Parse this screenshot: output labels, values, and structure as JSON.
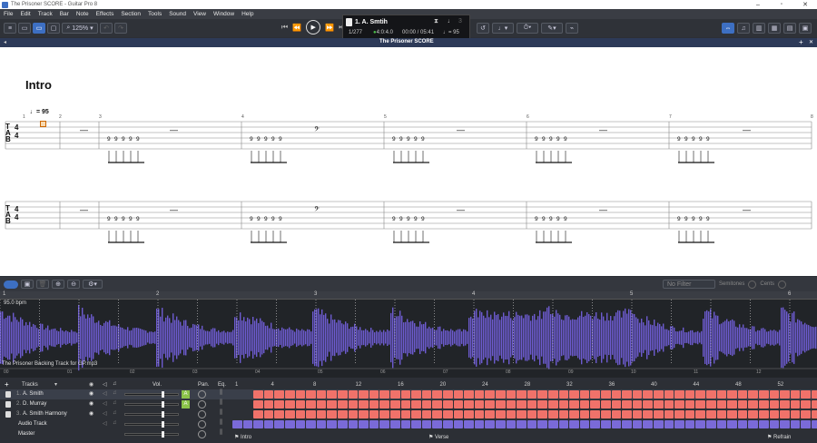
{
  "window": {
    "title": "The Prisoner SCORE - Guitar Pro 8"
  },
  "menu": [
    "File",
    "Edit",
    "Track",
    "Bar",
    "Note",
    "Effects",
    "Section",
    "Tools",
    "Sound",
    "View",
    "Window",
    "Help"
  ],
  "toolbar": {
    "zoom": "125%"
  },
  "lcd": {
    "track": "1. A. Smtih",
    "bar": "1/277",
    "signature": "4:0:4.0",
    "time": "00:00 / 05:41",
    "tempo": "♩= 95"
  },
  "doc": {
    "tab_title": "The Prisoner SCORE"
  },
  "score": {
    "section": "Intro",
    "tempo": "= 95",
    "tab_letters": [
      "T",
      "A",
      "B"
    ],
    "time_sig": "4 4",
    "bar_numbers": [
      "1",
      "2",
      "3",
      "4",
      "5",
      "6",
      "7",
      "8"
    ]
  },
  "audio": {
    "filter": "No Filter",
    "semitones_label": "Semitones",
    "cents_label": "Cents",
    "bpm": "95.0 bpm",
    "file": "The Prisoner Backing Track for GP.mp3",
    "markers": [
      "1",
      "2",
      "3",
      "4",
      "5",
      "6"
    ],
    "timecodes": [
      "00",
      "01",
      "02",
      "03",
      "04",
      "05",
      "06",
      "07",
      "08",
      "09",
      "10",
      "11",
      "12",
      "13"
    ]
  },
  "tracks": {
    "header": {
      "tracks": "Tracks",
      "vol": "Vol.",
      "pan": "Pan.",
      "eq": "Eq."
    },
    "list": [
      {
        "num": "1.",
        "name": "A. Smith",
        "color": "#f0726a"
      },
      {
        "num": "2.",
        "name": "D. Murray",
        "color": "#f0726a"
      },
      {
        "num": "3.",
        "name": "A. Smith Harmony",
        "color": "#f0726a"
      },
      {
        "num": "",
        "name": "Audio Track",
        "color": "#7a6ad8"
      },
      {
        "num": "",
        "name": "Master",
        "color": ""
      }
    ],
    "bar_ruler": [
      "1",
      "4",
      "8",
      "12",
      "16",
      "20",
      "24",
      "28",
      "32",
      "36",
      "40",
      "44",
      "48",
      "52"
    ],
    "sections": [
      "Intro",
      "Verse",
      "Refrain"
    ]
  },
  "colors": {
    "accent": "#3d6fc2",
    "track_red": "#f0726a",
    "audio_purple": "#7a6ad8",
    "wave": "#6d5bd0"
  }
}
